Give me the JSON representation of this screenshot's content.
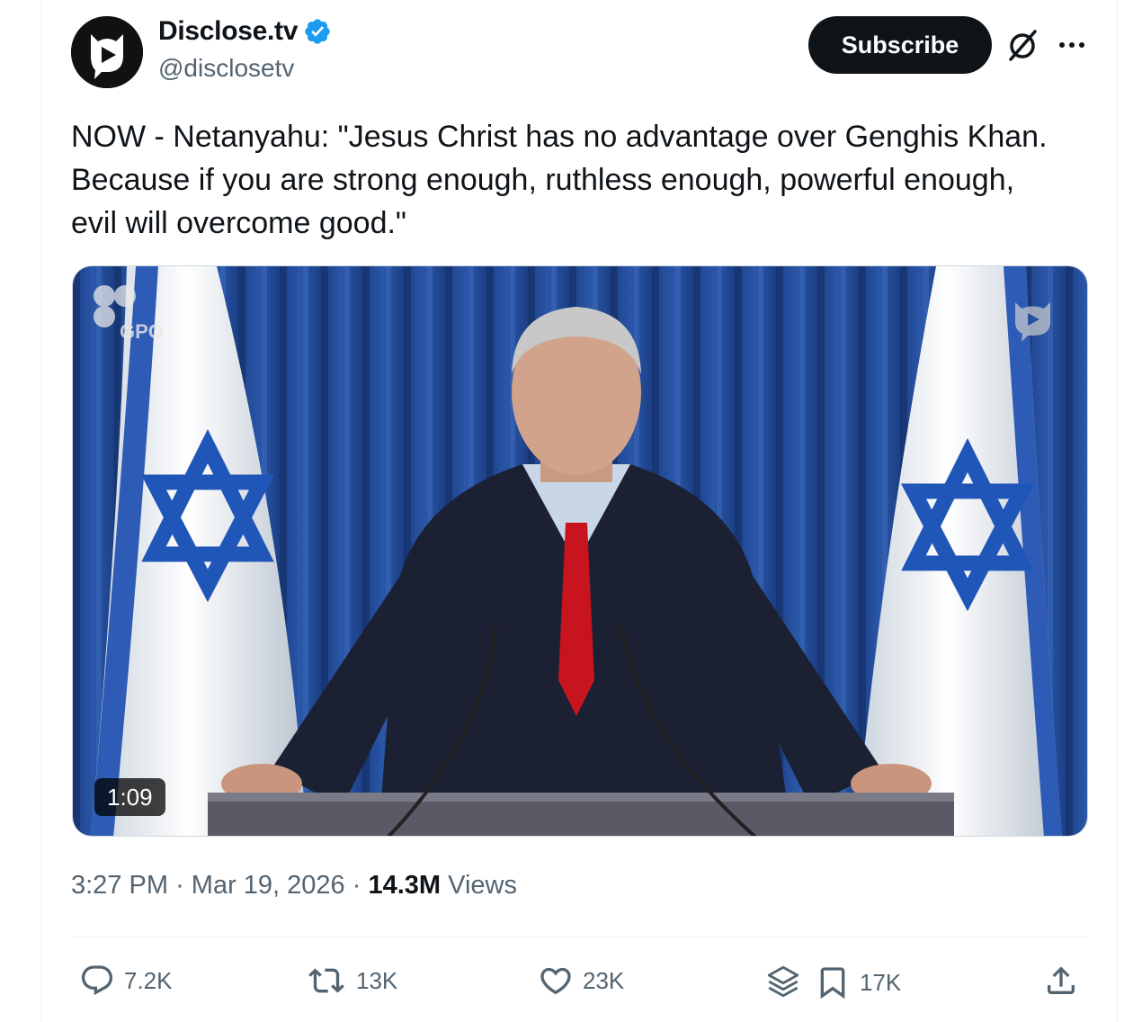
{
  "author": {
    "name": "Disclose.tv",
    "handle": "@disclosetv",
    "verified": true,
    "verified_color": "#1d9bf0"
  },
  "header": {
    "subscribe_label": "Subscribe",
    "grok_icon": "grok-icon",
    "more_icon": "more-icon"
  },
  "tweet": {
    "text": "NOW - Netanyahu: \"Jesus Christ has no advantage over Genghis Khan.\nBecause if you are strong enough, ruthless enough, powerful enough,\nevil will overcome good.\""
  },
  "media": {
    "type": "video",
    "duration": "1:09",
    "watermark": "GPO"
  },
  "meta": {
    "time": "3:27 PM",
    "date": "Mar 19, 2026",
    "separator": "·",
    "views_count": "14.3M",
    "views_label": "Views"
  },
  "actions": {
    "replies": "7.2K",
    "reposts": "13K",
    "likes": "23K",
    "bookmarks": "17K"
  },
  "colors": {
    "text": "#0f1419",
    "secondary": "#536471",
    "button": "#0f1419"
  }
}
